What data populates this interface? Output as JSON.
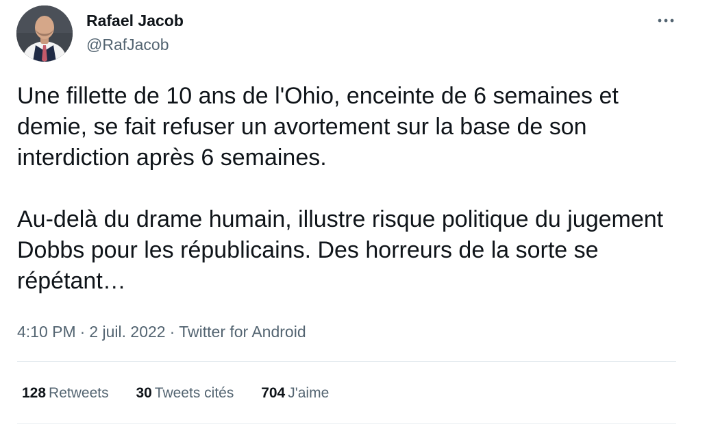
{
  "author": {
    "display_name": "Rafael Jacob",
    "handle": "@RafJacob",
    "avatar_icon": "user-avatar"
  },
  "menu": {
    "icon": "more-horizontal-icon"
  },
  "tweet": {
    "paragraphs": [
      "Une fillette de 10 ans de l'Ohio, enceinte de 6 semaines et demie, se fait refuser un avortement sur la base de son interdiction après 6 semaines.",
      "Au-delà du drame humain, illustre risque politique du jugement Dobbs pour les républicains. Des horreurs de la sorte se répétant…"
    ]
  },
  "meta": {
    "time": "4:10 PM",
    "separator": "·",
    "date": "2 juil. 2022",
    "source": "Twitter for Android"
  },
  "stats": {
    "retweets_count": "128",
    "retweets_label": "Retweets",
    "quotes_count": "30",
    "quotes_label": "Tweets cités",
    "likes_count": "704",
    "likes_label": "J'aime"
  },
  "colors": {
    "text_primary": "#0f1419",
    "text_secondary": "#536471",
    "divider": "#e6ecf0"
  }
}
